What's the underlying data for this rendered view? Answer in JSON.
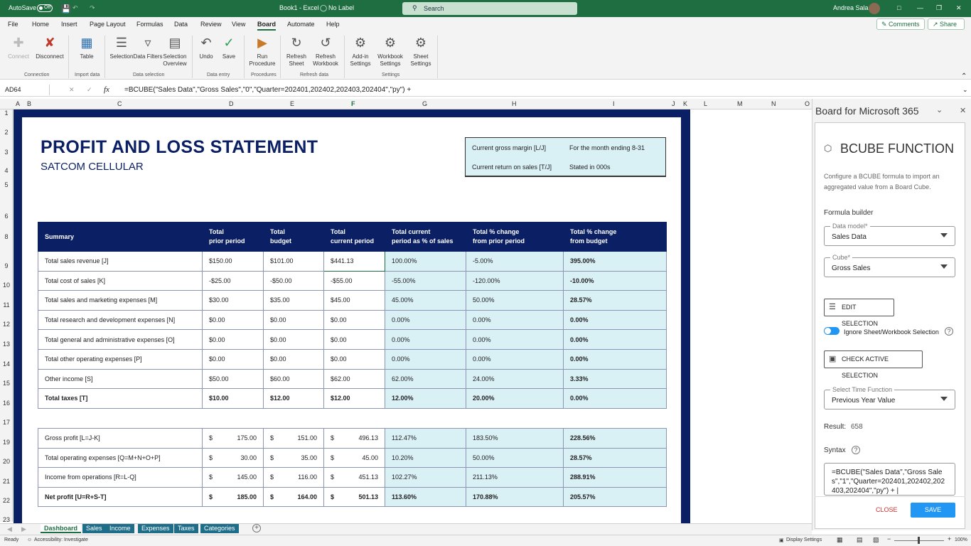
{
  "titlebar": {
    "autosave_label": "AutoSave",
    "autosave_state": "Off",
    "doc_title": "Book1 - Excel",
    "sensitivity": "No Label",
    "search_placeholder": "Search",
    "user": "Andrea Sala"
  },
  "menu": [
    "File",
    "Home",
    "Insert",
    "Page Layout",
    "Formulas",
    "Data",
    "Review",
    "View",
    "Board",
    "Automate",
    "Help"
  ],
  "menu_active": "Board",
  "top_buttons": {
    "comments": "Comments",
    "share": "Share"
  },
  "ribbon": {
    "buttons": [
      {
        "label": "Connect",
        "icon": "plug-icon",
        "disabled": true
      },
      {
        "label": "Disconnect",
        "icon": "unplug-icon"
      },
      {
        "label": "Table",
        "icon": "table-icon"
      },
      {
        "label": "Selection",
        "icon": "selection-icon"
      },
      {
        "label": "Data Filters",
        "icon": "filter-icon"
      },
      {
        "label": "Selection Overview",
        "icon": "overview-icon"
      },
      {
        "label": "Undo",
        "icon": "undo-icon"
      },
      {
        "label": "Save",
        "icon": "check-icon"
      },
      {
        "label": "Run Procedure",
        "icon": "procedure-icon"
      },
      {
        "label": "Refresh Sheet",
        "icon": "refresh-icon"
      },
      {
        "label": "Refresh Workbook",
        "icon": "refresh-workbook-icon"
      },
      {
        "label": "Add-in Settings",
        "icon": "gear-icon"
      },
      {
        "label": "Workbook Settings",
        "icon": "gear-icon"
      },
      {
        "label": "Sheet Settings",
        "icon": "gear-icon"
      }
    ],
    "groups": [
      "Connection",
      "Import data",
      "Data selection",
      "Data entry",
      "Procedures",
      "Refresh data",
      "Settings"
    ]
  },
  "formula_bar": {
    "name_box": "AD64",
    "formula": "=BCUBE(\"Sales Data\",\"Gross Sales\",\"0\",\"Quarter=202401,202402,202403,202404\",\"py\") +"
  },
  "columns": [
    "A",
    "B",
    "C",
    "D",
    "E",
    "F",
    "G",
    "H",
    "I",
    "J",
    "K",
    "L",
    "M",
    "N",
    "O"
  ],
  "rows": [
    "1",
    "2",
    "3",
    "4",
    "5",
    "6",
    "7",
    "8",
    "9",
    "10",
    "11",
    "12",
    "13",
    "14",
    "15",
    "16",
    "17",
    "18",
    "19",
    "20",
    "21",
    "22",
    "23"
  ],
  "report": {
    "title": "PROFIT AND LOSS STATEMENT",
    "company": "SATCOM CELLULAR",
    "info": {
      "margin_label": "Current gross margin  [L/J]",
      "period": "For the month ending 8-31",
      "return_label": "Current return on sales  [T/J]",
      "units": "Stated in 000s"
    },
    "headers": [
      "Summary",
      "Total\nprior period",
      "Total\nbudget",
      "Total\ncurrent period",
      "Total current\nperiod as % of sales",
      "Total % change\nfrom prior period",
      "Total % change\nfrom budget"
    ],
    "rows": [
      [
        "Total sales revenue  [J]",
        "$150.00",
        "$101.00",
        "$441.13",
        "100.00%",
        "-5.00%",
        "395.00%"
      ],
      [
        "Total cost of sales  [K]",
        "-$25.00",
        "-$50.00",
        "-$55.00",
        "-55.00%",
        "-120.00%",
        "-10.00%"
      ],
      [
        "Total sales and marketing expenses  [M]",
        "$30.00",
        "$35.00",
        "$45.00",
        "45.00%",
        "50.00%",
        "28.57%"
      ],
      [
        "Total research and development expenses  [N]",
        "$0.00",
        "$0.00",
        "$0.00",
        "0.00%",
        "0.00%",
        "0.00%"
      ],
      [
        "Total general and administrative expenses  [O]",
        "$0.00",
        "$0.00",
        "$0.00",
        "0.00%",
        "0.00%",
        "0.00%"
      ],
      [
        "Total other operating expenses [P]",
        "$0.00",
        "$0.00",
        "$0.00",
        "0.00%",
        "0.00%",
        "0.00%"
      ],
      [
        "Other income  [S]",
        "$50.00",
        "$60.00",
        "$62.00",
        "62.00%",
        "24.00%",
        "3.33%"
      ],
      [
        "Total taxes  [T]",
        "$10.00",
        "$12.00",
        "$12.00",
        "12.00%",
        "20.00%",
        "0.00%"
      ]
    ],
    "summary_rows": [
      [
        "Gross profit  [L=J-K]",
        "175.00",
        "151.00",
        "496.13",
        "112.47%",
        "183.50%",
        "228.56%"
      ],
      [
        "Total operating expenses  [Q=M+N+O+P]",
        "30.00",
        "35.00",
        "45.00",
        "10.20%",
        "50.00%",
        "28.57%"
      ],
      [
        "Income from operations  [R=L-Q]",
        "145.00",
        "116.00",
        "451.13",
        "102.27%",
        "211.13%",
        "288.91%"
      ],
      [
        "Net profit  [U=R+S-T]",
        "185.00",
        "164.00",
        "501.13",
        "113.60%",
        "170.88%",
        "205.57%"
      ]
    ],
    "currency_symbol": "$"
  },
  "pane": {
    "title": "Board for Microsoft 365",
    "function_title": "BCUBE FUNCTION",
    "description": "Configure a BCUBE formula to import an aggregated value from a Board Cube.",
    "builder_label": "Formula builder",
    "data_model": {
      "label": "Data model*",
      "value": "Sales Data"
    },
    "cube": {
      "label": "Cube*",
      "value": "Gross Sales"
    },
    "edit_selection": "EDIT SELECTION",
    "ignore_toggle": "Ignore Sheet/Workbook Selection",
    "check_selection": "CHECK ACTIVE SELECTION",
    "time_function": {
      "label": "Select Time Function",
      "value": "Previous Year Value"
    },
    "result_label": "Result:",
    "result_value": "658",
    "syntax_label": "Syntax",
    "syntax": "=BCUBE(\"Sales Data\",\"Gross Sales\",\"1\",\"Quarter=202401,202402,202403,202404\",\"py\") + |",
    "close": "CLOSE",
    "save": "SAVE"
  },
  "sheets": [
    "Dashboard",
    "Sales",
    "Income",
    "Expenses",
    "Taxes",
    "Categories"
  ],
  "active_sheet": "Dashboard",
  "status": {
    "ready": "Ready",
    "accessibility": "Accessibility: Investigate",
    "display_settings": "Display Settings",
    "zoom": "100%"
  },
  "colors": {
    "excel_green": "#1e6e41",
    "navy": "#0a1f64",
    "light_blue": "#d9f0f5",
    "accent_blue": "#2196f3"
  }
}
